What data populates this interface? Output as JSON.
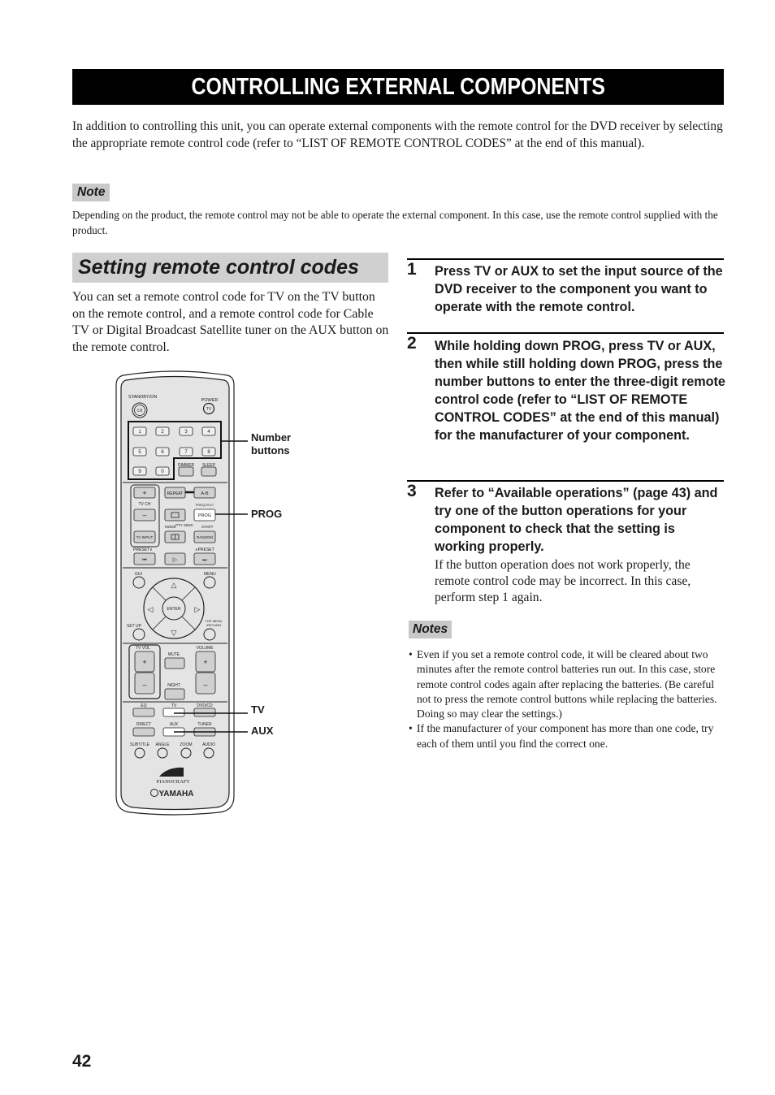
{
  "page": {
    "title": "CONTROLLING EXTERNAL COMPONENTS",
    "intro": "In addition to controlling this unit, you can operate external components with the remote control for the DVD receiver by selecting the appropriate remote control code (refer to “LIST OF REMOTE CONTROL CODES” at the end of this manual).",
    "note_label": "Note",
    "note_text": "Depending on the product, the remote control may not be able to operate the external component. In this case, use the remote control supplied with the product.",
    "page_number": "42"
  },
  "section": {
    "heading": "Setting remote control codes",
    "body": "You can set a remote control code for TV on the TV button on the remote control, and a remote control code for Cable TV or Digital Broadcast Satellite tuner on the AUX button on the remote control."
  },
  "steps": [
    {
      "number": "1",
      "text": "Press TV or AUX to set the input source of the DVD receiver to the component you want to operate with the remote control."
    },
    {
      "number": "2",
      "text": "While holding down PROG, press TV or AUX, then while still holding down PROG, press the number buttons to enter the three-digit remote control code (refer to “LIST OF REMOTE CONTROL CODES” at the end of this manual) for the manufacturer of your component."
    },
    {
      "number": "3",
      "text": "Refer to “Available operations” (page 43) and try one of the button operations for your component to check that the setting is working properly.",
      "sub": "If the button operation does not work properly, the remote control code may be incorrect. In this case, perform step 1 again."
    }
  ],
  "notes": {
    "label": "Notes",
    "items": [
      "Even if you set a remote control code, it will be cleared about two minutes after the remote control batteries run out. In this case, store remote control codes again after replacing the batteries. (Be careful not to press the remote control buttons while replacing the batteries. Doing so may clear the settings.)",
      "If the manufacturer of your component has more than one code, try each of them until you find the correct one."
    ]
  },
  "callouts": {
    "number_buttons": "Number buttons",
    "prog": "PROG",
    "tv": "TV",
    "aux": "AUX"
  },
  "remote": {
    "standby": "STANDBY/ON",
    "standby_glyph": "⏻/I",
    "power": "POWER",
    "power_tv": "TV",
    "digits": [
      "1",
      "2",
      "3",
      "4",
      "5",
      "6",
      "7",
      "8",
      "9",
      "0"
    ],
    "dimmer": "DIMMER",
    "sleep": "SLEEP",
    "repeat": "REPEAT",
    "ab": "A-B",
    "tv_ch": "TV CH",
    "freq_text": "FREQ/TEXT",
    "prog": "PROG",
    "mode": "MODE",
    "pty_seek": "PTY SEEK",
    "start": "START",
    "tv_input": "TV INPUT",
    "random": "RANDOM",
    "preset_down": "PRESET∨",
    "preset_up": "∧PRESET",
    "gui": "GUI",
    "menu": "MENU",
    "enter": "ENTER",
    "set_up": "SET UP",
    "top_menu": "TOP MENU",
    "return": "/RETURN",
    "tv_vol": "TV VOL",
    "volume": "VOLUME",
    "mute": "MUTE",
    "night": "NIGHT",
    "eq": "EQ",
    "tv": "TV",
    "dvdcd": "DVD/CD",
    "direct": "DIRECT",
    "aux": "AUX",
    "tuner": "TUNER",
    "subtitle": "SUBTITLE",
    "angle": "ANGLE",
    "zoom": "ZOOM",
    "audio": "AUDIO",
    "pianocraft": "PIANOCRAFT",
    "brand": "YAMAHA"
  }
}
